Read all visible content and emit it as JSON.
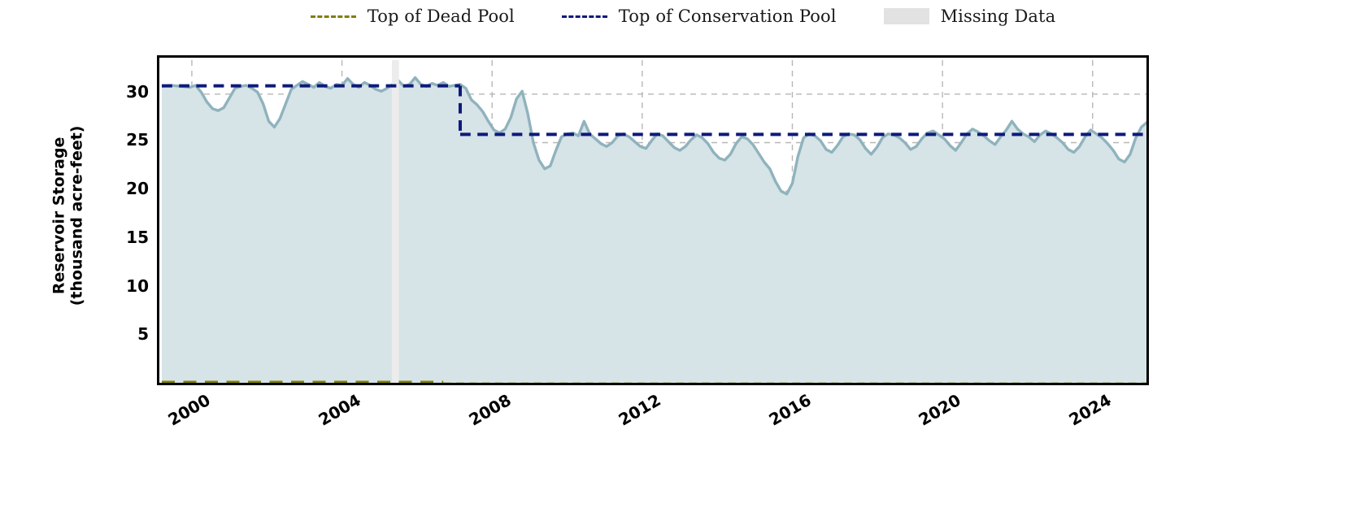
{
  "legend": {
    "entries": [
      {
        "label": "Top of Dead Pool",
        "marker": "dashed-line",
        "color": "#808000"
      },
      {
        "label": "Top of Conservation Pool",
        "marker": "dashed-line",
        "color": "#0d1a7a"
      },
      {
        "label": "Missing Data",
        "marker": "filled-patch",
        "color": "#e2e2e2"
      }
    ]
  },
  "axes": {
    "ylabel_line1": "Reservoir Storage",
    "ylabel_line2": "(thousand acre-feet)",
    "yticks": [
      "5",
      "10",
      "15",
      "20",
      "25",
      "30"
    ],
    "xticks": [
      "2000",
      "2004",
      "2008",
      "2012",
      "2016",
      "2020",
      "2024"
    ]
  },
  "chart_data": {
    "type": "area",
    "title": "",
    "xlabel": "",
    "ylabel": "Reservoir Storage (thousand acre-feet)",
    "xlim": [
      1999.2,
      2025.5
    ],
    "ylim": [
      0,
      33.5
    ],
    "ytick_values": [
      5,
      10,
      15,
      20,
      25,
      30
    ],
    "xtick_values": [
      2000,
      2004,
      2008,
      2012,
      2016,
      2020,
      2024
    ],
    "grid": true,
    "legend_position": "above-plot-center",
    "series": [
      {
        "name": "Reservoir Storage",
        "type": "area",
        "line_color": "#8fb3bd",
        "fill_color": "#d6e3e7",
        "x": [
          1999.2,
          1999.45,
          1999.7,
          1999.95,
          2000.1,
          2000.25,
          2000.4,
          2000.55,
          2000.7,
          2000.85,
          2001.0,
          2001.15,
          2001.3,
          2001.45,
          2001.6,
          2001.75,
          2001.9,
          2002.05,
          2002.2,
          2002.35,
          2002.5,
          2002.65,
          2002.8,
          2002.95,
          2003.1,
          2003.25,
          2003.4,
          2003.55,
          2003.7,
          2003.85,
          2004.0,
          2004.15,
          2004.3,
          2004.45,
          2004.6,
          2004.75,
          2004.9,
          2005.05,
          2005.2,
          2005.35,
          2005.5,
          2005.65,
          2005.8,
          2005.95,
          2006.1,
          2006.25,
          2006.4,
          2006.55,
          2006.7,
          2006.85,
          2007.0,
          2007.15,
          2007.3,
          2007.45,
          2007.6,
          2007.75,
          2007.9,
          2008.05,
          2008.2,
          2008.35,
          2008.5,
          2008.65,
          2008.8,
          2008.95,
          2009.1,
          2009.25,
          2009.4,
          2009.55,
          2009.7,
          2009.85,
          2010.0,
          2010.15,
          2010.3,
          2010.45,
          2010.6,
          2010.75,
          2010.9,
          2011.05,
          2011.2,
          2011.35,
          2011.5,
          2011.65,
          2011.8,
          2011.95,
          2012.1,
          2012.25,
          2012.4,
          2012.55,
          2012.7,
          2012.85,
          2013.0,
          2013.15,
          2013.3,
          2013.45,
          2013.6,
          2013.75,
          2013.9,
          2014.05,
          2014.2,
          2014.35,
          2014.5,
          2014.65,
          2014.8,
          2014.95,
          2015.1,
          2015.25,
          2015.4,
          2015.55,
          2015.7,
          2015.85,
          2016.0,
          2016.15,
          2016.3,
          2016.45,
          2016.6,
          2016.75,
          2016.9,
          2017.05,
          2017.2,
          2017.35,
          2017.5,
          2017.65,
          2017.8,
          2017.95,
          2018.1,
          2018.25,
          2018.4,
          2018.55,
          2018.7,
          2018.85,
          2019.0,
          2019.15,
          2019.3,
          2019.45,
          2019.6,
          2019.75,
          2019.9,
          2020.05,
          2020.2,
          2020.35,
          2020.5,
          2020.65,
          2020.8,
          2020.95,
          2021.1,
          2021.25,
          2021.4,
          2021.55,
          2021.7,
          2021.85,
          2022.0,
          2022.15,
          2022.3,
          2022.45,
          2022.6,
          2022.75,
          2022.9,
          2023.05,
          2023.2,
          2023.35,
          2023.5,
          2023.65,
          2023.8,
          2023.95,
          2024.1,
          2024.25,
          2024.4,
          2024.55,
          2024.7,
          2024.85,
          2025.0,
          2025.15,
          2025.3,
          2025.45
        ],
        "y": [
          30.8,
          30.9,
          30.8,
          30.7,
          30.9,
          30.2,
          29.2,
          28.5,
          28.3,
          28.6,
          29.6,
          30.6,
          30.8,
          30.9,
          30.6,
          30.2,
          29.0,
          27.2,
          26.6,
          27.5,
          29.0,
          30.5,
          30.9,
          31.3,
          31.0,
          30.7,
          31.2,
          30.8,
          30.6,
          31.0,
          30.9,
          31.6,
          31.0,
          30.7,
          31.2,
          30.9,
          30.5,
          30.3,
          30.6,
          31.0,
          31.4,
          30.8,
          31.0,
          31.7,
          31.0,
          30.8,
          31.1,
          30.9,
          31.2,
          30.8,
          30.9,
          31.0,
          30.6,
          29.4,
          28.9,
          28.2,
          27.2,
          26.3,
          26.0,
          26.4,
          27.6,
          29.5,
          30.3,
          28.0,
          25.0,
          23.2,
          22.3,
          22.6,
          24.2,
          25.6,
          25.9,
          26.0,
          25.7,
          27.2,
          25.9,
          25.4,
          24.9,
          24.6,
          25.0,
          25.7,
          25.9,
          25.6,
          25.1,
          24.6,
          24.4,
          25.2,
          25.9,
          25.7,
          25.1,
          24.5,
          24.2,
          24.6,
          25.3,
          25.8,
          25.5,
          24.9,
          24.0,
          23.4,
          23.2,
          23.8,
          24.9,
          25.6,
          25.4,
          24.8,
          23.9,
          23.0,
          22.3,
          21.0,
          20.0,
          19.7,
          20.8,
          23.6,
          25.5,
          25.9,
          25.7,
          25.2,
          24.3,
          24.0,
          24.7,
          25.6,
          25.9,
          25.8,
          25.3,
          24.4,
          23.8,
          24.5,
          25.5,
          25.9,
          25.8,
          25.5,
          25.0,
          24.3,
          24.6,
          25.4,
          26.0,
          26.2,
          25.8,
          25.4,
          24.7,
          24.2,
          25.0,
          25.9,
          26.4,
          26.1,
          25.7,
          25.2,
          24.8,
          25.6,
          26.3,
          27.2,
          26.4,
          25.9,
          25.6,
          25.1,
          25.8,
          26.2,
          25.9,
          25.5,
          25.0,
          24.3,
          24.0,
          24.6,
          25.6,
          26.3,
          25.9,
          25.5,
          24.9,
          24.2,
          23.3,
          23.0,
          23.8,
          25.5,
          26.6,
          27.1
        ]
      }
    ],
    "reference_lines": [
      {
        "name": "Top of Dead Pool",
        "color": "#808000",
        "style": "dashed",
        "value": 0.15,
        "segments": [
          {
            "x_start": 1999.2,
            "x_end": 2006.7,
            "value": 0.25,
            "width": 5
          },
          {
            "x_start": 2006.7,
            "x_end": 2025.5,
            "value": 0.15,
            "width": 3
          }
        ]
      },
      {
        "name": "Top of Conservation Pool",
        "color": "#0d1a7a",
        "style": "dashed",
        "segments": [
          {
            "x_start": 1999.2,
            "x_end": 2007.15,
            "value": 30.85
          },
          {
            "x_start": 2007.15,
            "x_end": 2025.5,
            "value": 25.85
          }
        ]
      }
    ],
    "missing_data_bands": [
      {
        "x_start": 2005.33,
        "x_end": 2005.52,
        "color": "#ececec"
      }
    ]
  }
}
